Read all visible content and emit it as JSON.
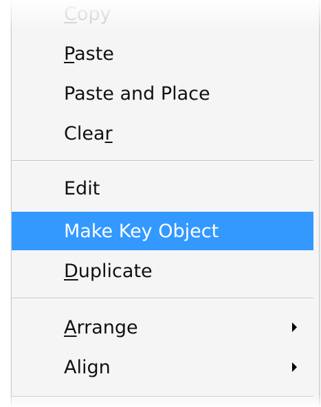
{
  "context_menu": {
    "items": {
      "copy": {
        "label_pre": "",
        "label_u": "C",
        "label_post": "opy"
      },
      "paste": {
        "label_pre": "",
        "label_u": "P",
        "label_post": "aste"
      },
      "paste_and_place": {
        "label": "Paste and Place"
      },
      "clear": {
        "label_pre": "Clea",
        "label_u": "r",
        "label_post": ""
      },
      "edit": {
        "label": "Edit"
      },
      "make_key_object": {
        "label": "Make Key Object"
      },
      "duplicate": {
        "label_pre": "",
        "label_u": "D",
        "label_post": "uplicate"
      },
      "arrange": {
        "label_pre": "",
        "label_u": "A",
        "label_post": "rrange"
      },
      "align": {
        "label": "Align"
      }
    },
    "submenu_arrow_icon": "triangle-right",
    "colors": {
      "highlight_bg": "#3399ff",
      "highlight_text": "#ffffff",
      "disabled_text": "#c8c8c8",
      "text": "#111111",
      "background": "#f5f5f5"
    }
  }
}
